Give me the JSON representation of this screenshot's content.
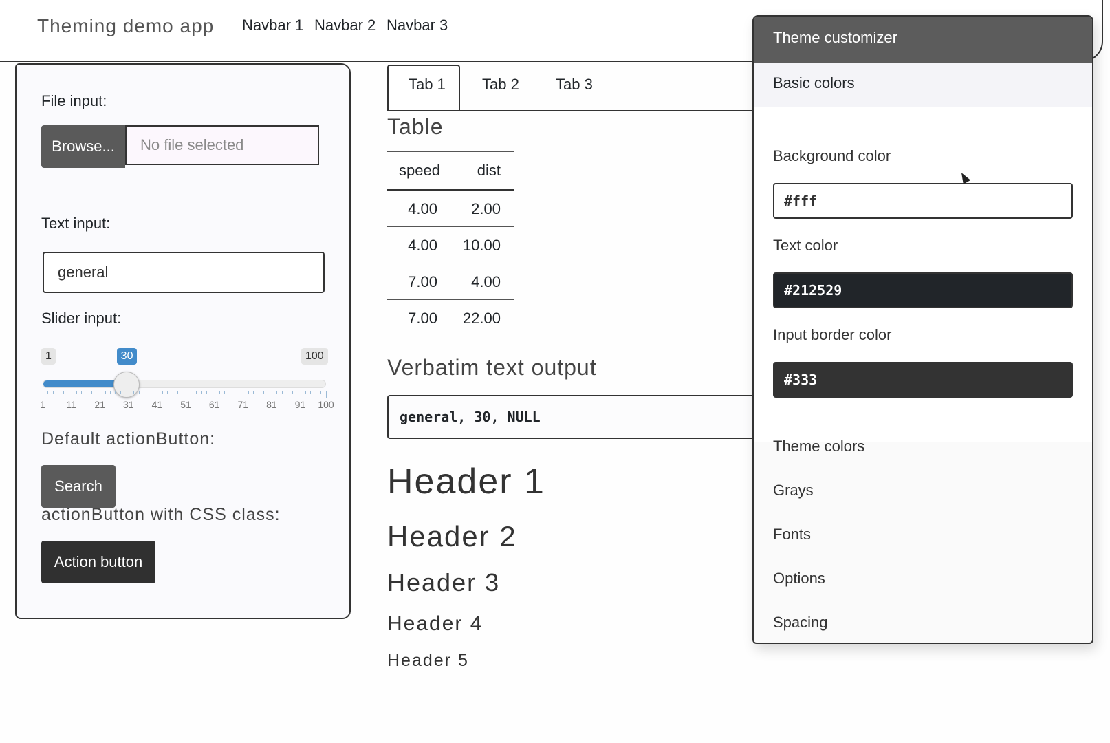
{
  "navbar": {
    "brand": "Theming demo app",
    "links": [
      "Navbar 1",
      "Navbar 2",
      "Navbar 3"
    ]
  },
  "sidebar": {
    "file_label": "File input:",
    "browse_label": "Browse...",
    "file_placeholder": "No file selected",
    "text_label": "Text input:",
    "text_value": "general",
    "slider_label": "Slider input:",
    "slider": {
      "min": 1,
      "max": 100,
      "value": 30,
      "min_label": "1",
      "max_label": "100",
      "value_label": "30",
      "ticks": [
        "1",
        "11",
        "21",
        "31",
        "41",
        "51",
        "61",
        "71",
        "81",
        "91",
        "100"
      ]
    },
    "default_btn_label": "Default actionButton:",
    "search_label": "Search",
    "css_btn_label": "actionButton with CSS class:",
    "action_label": "Action button"
  },
  "main": {
    "tabs": [
      "Tab 1",
      "Tab 2",
      "Tab 3"
    ],
    "table_title": "Table",
    "table": {
      "headers": [
        "speed",
        "dist"
      ],
      "rows": [
        [
          "4.00",
          "2.00"
        ],
        [
          "4.00",
          "10.00"
        ],
        [
          "7.00",
          "4.00"
        ],
        [
          "7.00",
          "22.00"
        ]
      ]
    },
    "verbatim_title": "Verbatim text output",
    "verbatim_value": "general, 30, NULL",
    "headers": [
      "Header 1",
      "Header 2",
      "Header 3",
      "Header 4",
      "Header 5"
    ]
  },
  "customizer": {
    "title": "Theme customizer",
    "basic_colors": "Basic colors",
    "bg_label": "Background color",
    "bg_value": "#fff",
    "text_label": "Text color",
    "text_value": "#212529",
    "border_label": "Input border color",
    "border_value": "#333",
    "sections": [
      "Theme colors",
      "Grays",
      "Fonts",
      "Options",
      "Spacing"
    ]
  }
}
